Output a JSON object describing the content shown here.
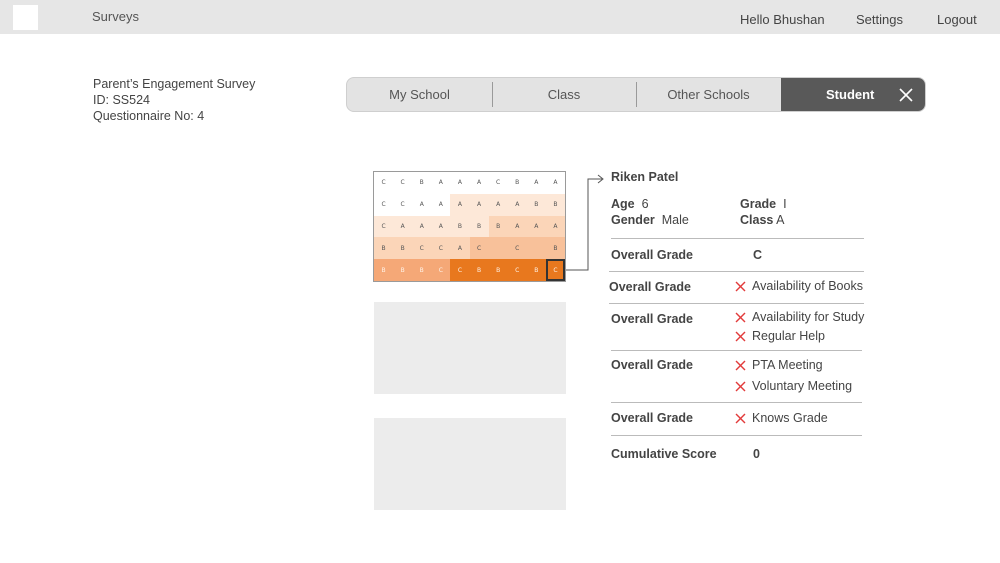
{
  "header": {
    "app_title": "Surveys",
    "greeting": "Hello Bhushan",
    "settings": "Settings",
    "logout": "Logout"
  },
  "survey": {
    "name": "Parent’s Engagement Survey",
    "id_line": "ID: SS524",
    "questionnaire_line": "Questionnaire No: 4"
  },
  "tabs": [
    {
      "label": "My School"
    },
    {
      "label": "Class"
    },
    {
      "label": "Other Schools"
    },
    {
      "label": "Student",
      "active": true
    }
  ],
  "heatmap": {
    "rows": [
      [
        "C",
        "C",
        "B",
        "A",
        "A",
        "A",
        "C",
        "B",
        "A",
        "A"
      ],
      [
        "C",
        "C",
        "A",
        "A",
        "A",
        "A",
        "A",
        "A",
        "B",
        "B"
      ],
      [
        "C",
        "A",
        "A",
        "A",
        "B",
        "B",
        "B",
        "A",
        "A",
        "A"
      ],
      [
        "B",
        "B",
        "C",
        "C",
        "A",
        "C",
        "",
        "C",
        "",
        "B"
      ],
      [
        "B",
        "B",
        "B",
        "C",
        "C",
        "B",
        "B",
        "C",
        "B",
        "C"
      ]
    ],
    "selected": {
      "row": 4,
      "col": 9
    }
  },
  "student": {
    "name": "Riken Patel",
    "age_label": "Age",
    "age_value": "6",
    "gender_label": "Gender",
    "gender_value": "Male",
    "grade_label": "Grade",
    "grade_value": "I",
    "class_label": "Class",
    "class_value": "A",
    "overall_label": "Overall Grade",
    "overall_value": "C",
    "criteria_groups": [
      {
        "label": "Overall Grade",
        "items": [
          "Availability of Books"
        ]
      },
      {
        "label": "Overall Grade",
        "items": [
          "Availability for Study",
          "Regular Help"
        ]
      },
      {
        "label": "Overall Grade",
        "items": [
          "PTA Meeting",
          "Voluntary Meeting"
        ]
      },
      {
        "label": "Overall Grade",
        "items": [
          "Knows Grade"
        ]
      }
    ],
    "cumulative_label": "Cumulative Score",
    "cumulative_value": "0"
  },
  "colors": {
    "accent": "#e8781e",
    "cross": "#e23b3b",
    "active_tab": "#595959"
  },
  "icons": {
    "close": "close-icon",
    "cross": "cross-icon"
  }
}
